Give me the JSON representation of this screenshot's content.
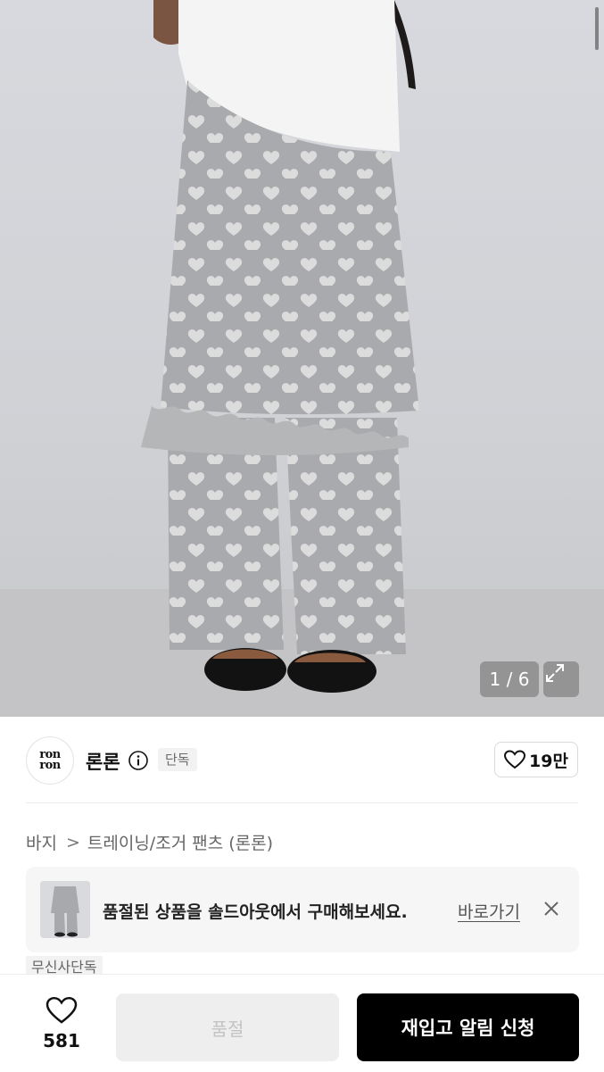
{
  "image": {
    "counter": "1 / 6",
    "subject": "model wearing heart-pattern gray pants with skirt layer"
  },
  "brand": {
    "logo_line1": "ron",
    "logo_line2": "ron",
    "name": "론론",
    "badge": "단독",
    "likes": "19만"
  },
  "breadcrumb": {
    "category": "바지",
    "separator": ">",
    "subcategory": "트레이닝/조거 팬츠 (론론)"
  },
  "soldout_banner": {
    "message": "품절된 상품을 솔드아웃에서 구매해보세요.",
    "link_label": "바로가기"
  },
  "tag": "무신사단독",
  "bottom_bar": {
    "wish_count": "581",
    "soldout_label": "품절",
    "restock_label": "재입고 알림 신청"
  },
  "colors": {
    "primary_button": "#000000",
    "disabled_button": "#eeeeee",
    "banner_bg": "#f6f6f6"
  }
}
